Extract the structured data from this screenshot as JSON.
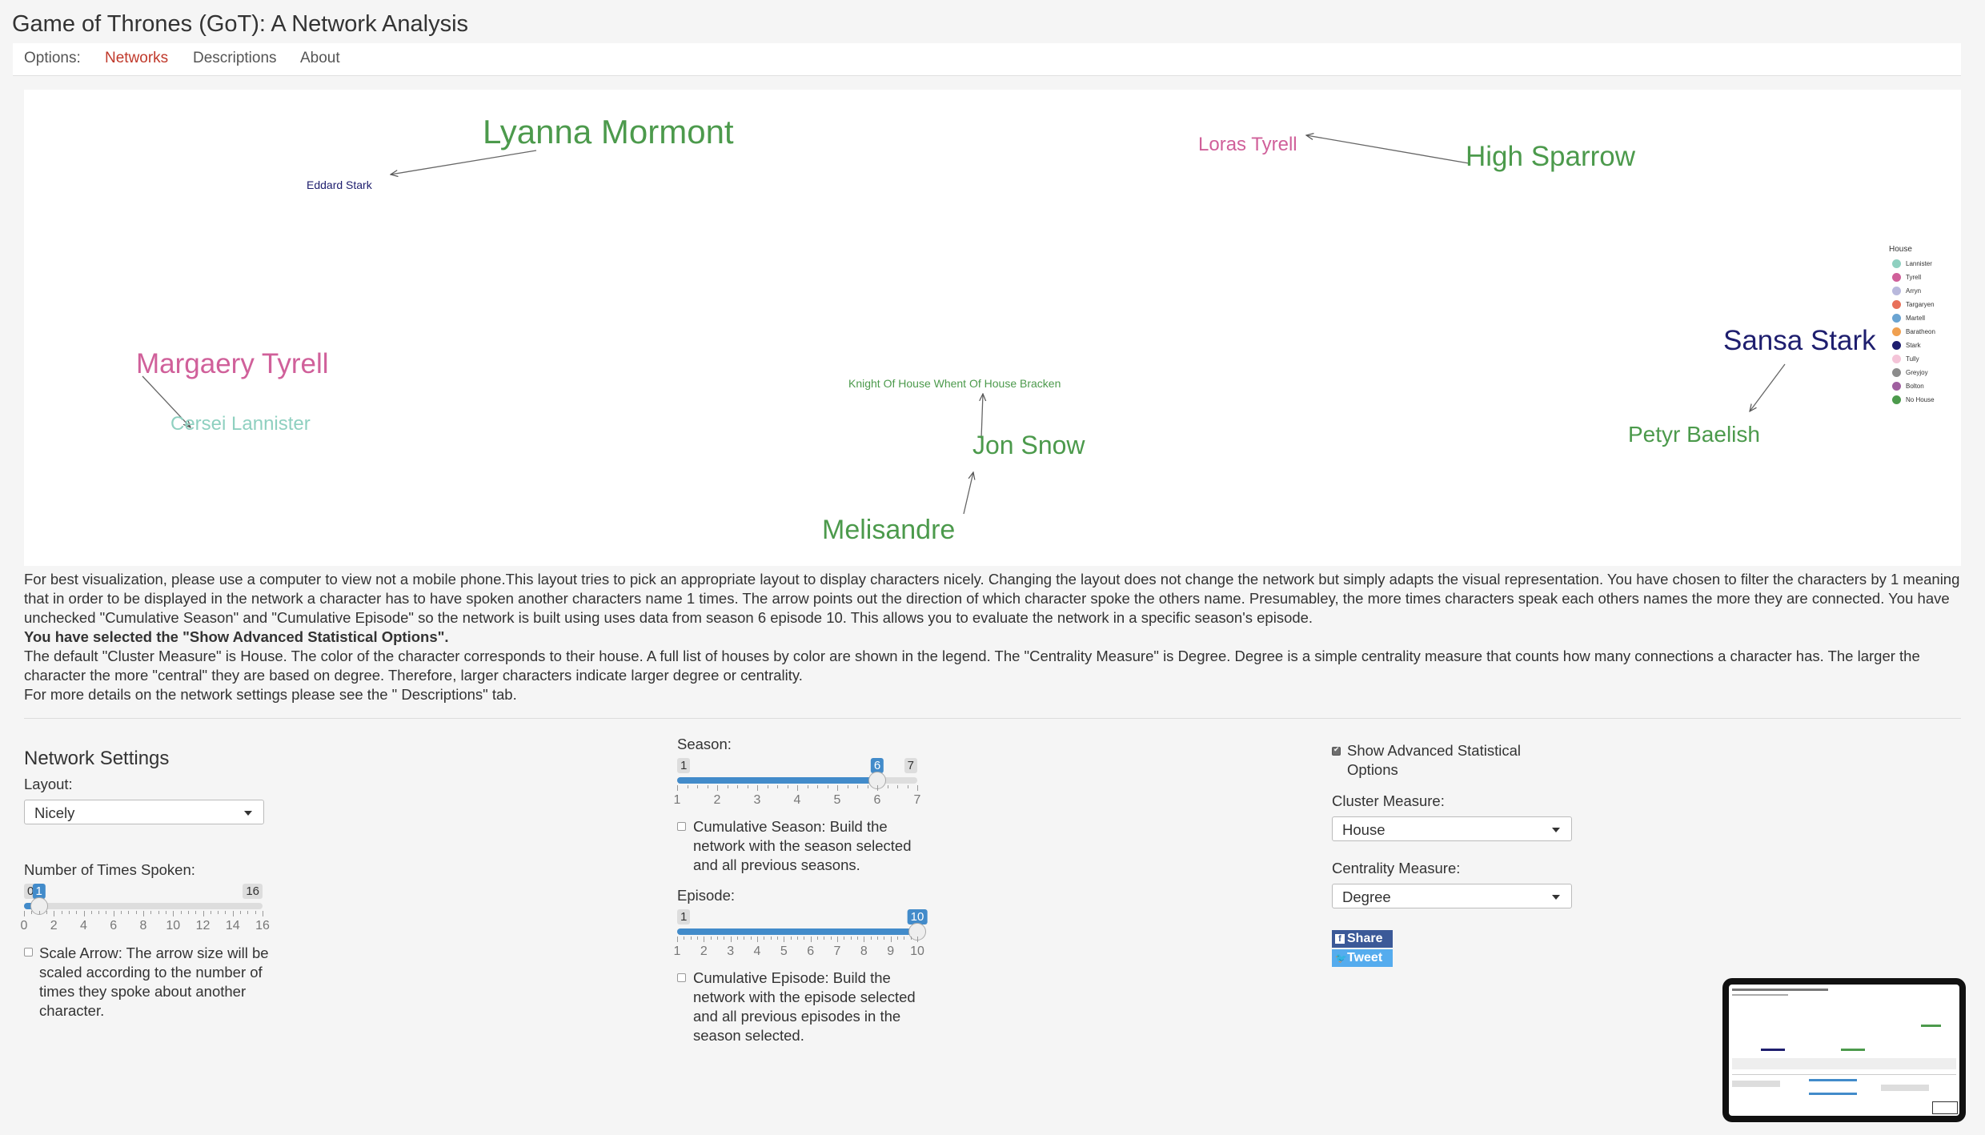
{
  "app": {
    "title": "Game of Thrones (GoT): A Network Analysis"
  },
  "nav": {
    "options_label": "Options:",
    "tabs": [
      "Networks",
      "Descriptions",
      "About"
    ],
    "active_tab": "Networks"
  },
  "network": {
    "nodes": [
      {
        "name": "Lyanna Mormont",
        "house": "No House"
      },
      {
        "name": "Eddard Stark",
        "house": "Stark"
      },
      {
        "name": "Loras Tyrell",
        "house": "Tyrell"
      },
      {
        "name": "High Sparrow",
        "house": "No House"
      },
      {
        "name": "Margaery Tyrell",
        "house": "Tyrell"
      },
      {
        "name": "Cersei Lannister",
        "house": "Lannister"
      },
      {
        "name": "Knight Of House Whent Of House Bracken",
        "house": "No House"
      },
      {
        "name": "Jon Snow",
        "house": "No House"
      },
      {
        "name": "Melisandre",
        "house": "No House"
      },
      {
        "name": "Sansa Stark",
        "house": "Stark"
      },
      {
        "name": "Petyr Baelish",
        "house": "No House"
      }
    ],
    "edges": [
      {
        "from": "Lyanna Mormont",
        "to": "Eddard Stark"
      },
      {
        "from": "High Sparrow",
        "to": "Loras Tyrell"
      },
      {
        "from": "Margaery Tyrell",
        "to": "Cersei Lannister"
      },
      {
        "from": "Jon Snow",
        "to": "Knight Of House Whent Of House Bracken"
      },
      {
        "from": "Melisandre",
        "to": "Jon Snow"
      },
      {
        "from": "Sansa Stark",
        "to": "Petyr Baelish"
      }
    ],
    "legend": {
      "title": "House",
      "items": [
        {
          "label": "Lannister",
          "color": "#8fd0c0"
        },
        {
          "label": "Tyrell",
          "color": "#d0609a"
        },
        {
          "label": "Arryn",
          "color": "#b8b8dc"
        },
        {
          "label": "Targaryen",
          "color": "#e8705a"
        },
        {
          "label": "Martell",
          "color": "#6aa4d2"
        },
        {
          "label": "Baratheon",
          "color": "#f0a050"
        },
        {
          "label": "Stark",
          "color": "#1e1e6e"
        },
        {
          "label": "Tully",
          "color": "#f4c4d8"
        },
        {
          "label": "Greyjoy",
          "color": "#8c8c8c"
        },
        {
          "label": "Bolton",
          "color": "#a060a0"
        },
        {
          "label": "No House",
          "color": "#4c9a4c"
        }
      ]
    }
  },
  "info": {
    "paragraph1": "For best visualization, please use a computer to view not a mobile phone.This layout tries to pick an appropriate layout to display characters nicely. Changing the layout does not change the network but simply adapts the visual representation. You have chosen to filter the characters by 1 meaning that in order to be displayed in the network a character has to have spoken another characters name 1 times. The arrow points out the direction of which character spoke the others name. Presumabley, the more times characters speak each others names the more they are connected. You have unchecked \"Cumulative Season\" and \"Cumulative Episode\" so the network is built using uses data from season 6 episode 10. This allows you to evaluate the network in a specific season's episode.",
    "advanced_notice": "You have selected the \"Show Advanced Statistical Options\".",
    "paragraph2": "The default \"Cluster Measure\" is House. The color of the character corresponds to their house. A full list of houses by color are shown in the legend. The \"Centrality Measure\" is Degree. Degree is a simple centrality measure that counts how many connections a character has. The larger the character the more \"central\" they are based on degree. Therefore, larger characters indicate larger degree or centrality.",
    "paragraph3": "For more details on the network settings please see the \" Descriptions\" tab."
  },
  "settings": {
    "heading": "Network Settings",
    "layout_label": "Layout:",
    "layout_value": "Nicely",
    "times_spoken_label": "Number of Times Spoken:",
    "times_spoken": {
      "min": 0,
      "max": 16,
      "value": 1,
      "min_label": "0",
      "max_label": "16",
      "value_label": "1",
      "ticks": [
        "0",
        "2",
        "4",
        "6",
        "8",
        "10",
        "12",
        "14",
        "16"
      ]
    },
    "scale_arrow_label": "Scale Arrow: The arrow size will be scaled according to the number of times they spoke about another character.",
    "scale_arrow_checked": false,
    "season_label": "Season:",
    "season": {
      "min": 1,
      "max": 7,
      "value": 6,
      "min_label": "1",
      "max_label": "7",
      "value_label": "6",
      "ticks": [
        "1",
        "2",
        "3",
        "4",
        "5",
        "6",
        "7"
      ]
    },
    "cumulative_season_label": "Cumulative Season: Build the network with the season selected and all previous seasons.",
    "cumulative_season_checked": false,
    "episode_label": "Episode:",
    "episode": {
      "min": 1,
      "max": 10,
      "value": 10,
      "min_label": "1",
      "value_label": "10",
      "ticks": [
        "1",
        "2",
        "3",
        "4",
        "5",
        "6",
        "7",
        "8",
        "9",
        "10"
      ]
    },
    "cumulative_episode_label": "Cumulative Episode: Build the network with the episode selected and all previous episodes in the season selected.",
    "cumulative_episode_checked": false,
    "advanced_label": "Show Advanced Statistical Options",
    "advanced_checked": true,
    "cluster_label": "Cluster Measure:",
    "cluster_value": "House",
    "centrality_label": "Centrality Measure:",
    "centrality_value": "Degree",
    "share_label": "Share",
    "tweet_label": "Tweet"
  }
}
